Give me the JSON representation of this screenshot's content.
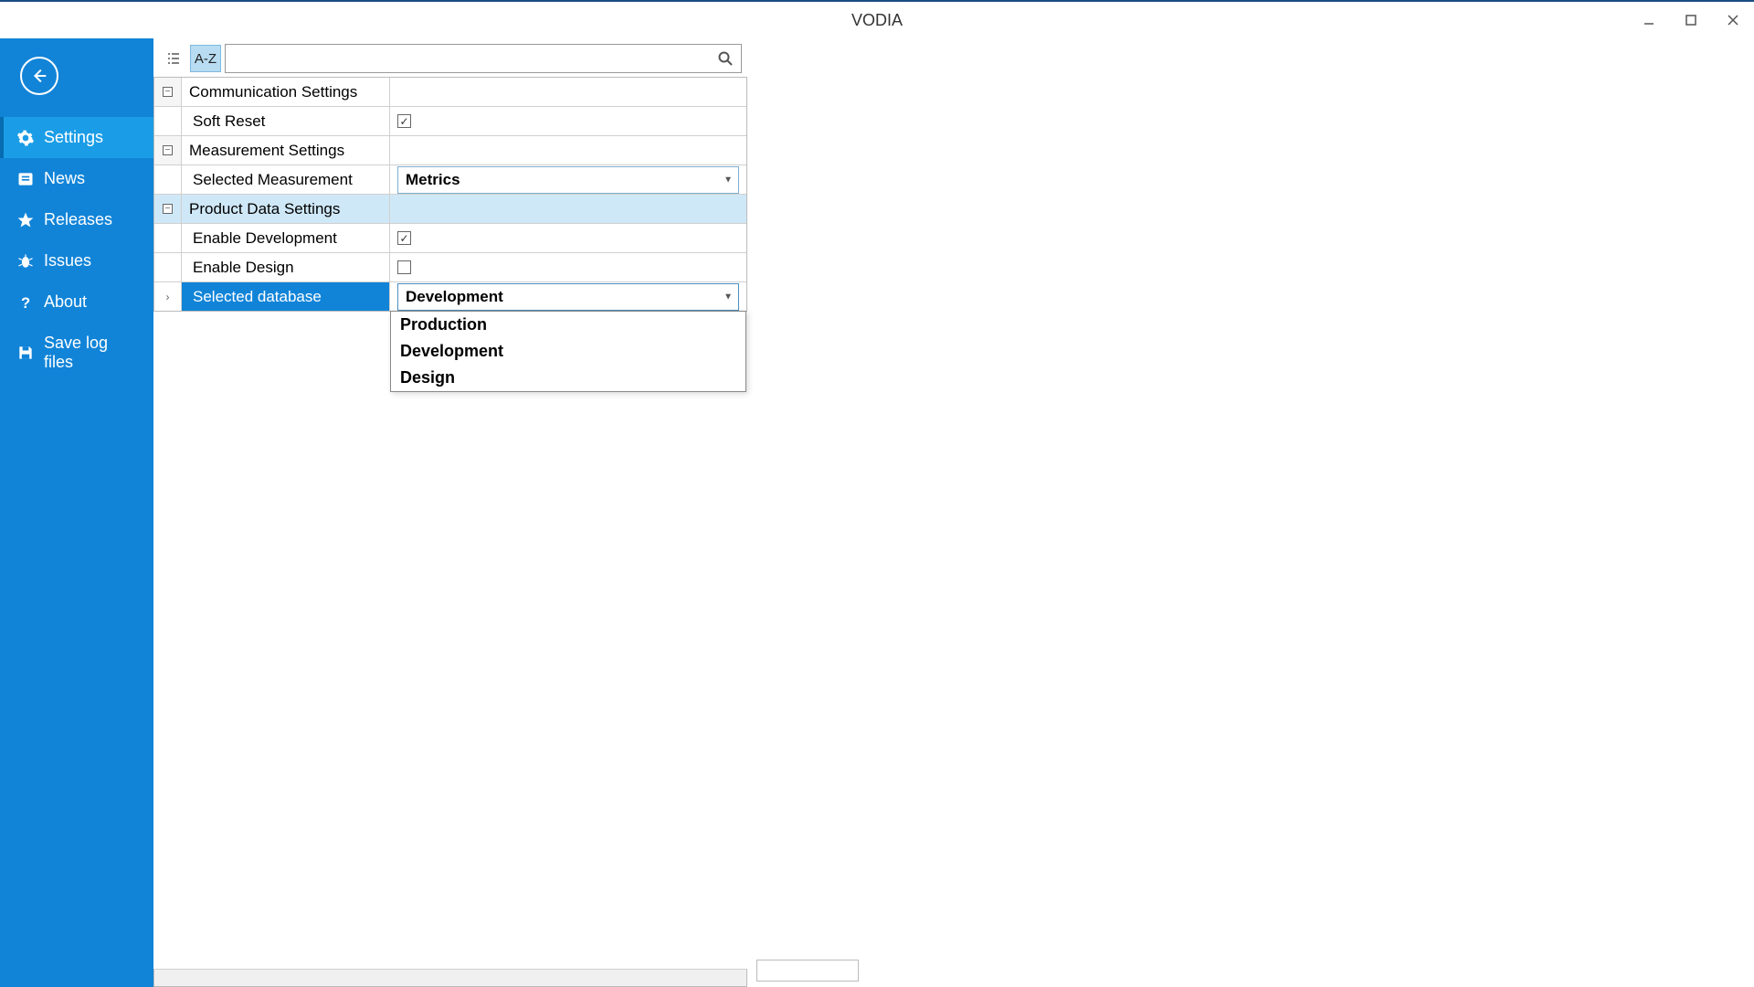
{
  "window": {
    "title": "VODIA"
  },
  "sidebar": {
    "items": [
      {
        "label": "Settings"
      },
      {
        "label": "News"
      },
      {
        "label": "Releases"
      },
      {
        "label": "Issues"
      },
      {
        "label": "About"
      },
      {
        "label": "Save log files"
      }
    ]
  },
  "toolbar": {
    "sort_az": "A-Z",
    "search_value": ""
  },
  "grid": {
    "categories": [
      {
        "name": "Communication Settings",
        "rows": [
          {
            "label": "Soft Reset",
            "type": "check",
            "checked": true
          }
        ]
      },
      {
        "name": "Measurement Settings",
        "rows": [
          {
            "label": "Selected Measurement",
            "type": "combo",
            "value": "Metrics"
          }
        ]
      },
      {
        "name": "Product Data Settings",
        "rows": [
          {
            "label": "Enable Development",
            "type": "check",
            "checked": true
          },
          {
            "label": "Enable Design",
            "type": "check",
            "checked": false
          },
          {
            "label": "Selected database",
            "type": "combo",
            "value": "Development"
          }
        ]
      }
    ],
    "dropdown": {
      "options": [
        "Production",
        "Development",
        "Design"
      ]
    }
  }
}
